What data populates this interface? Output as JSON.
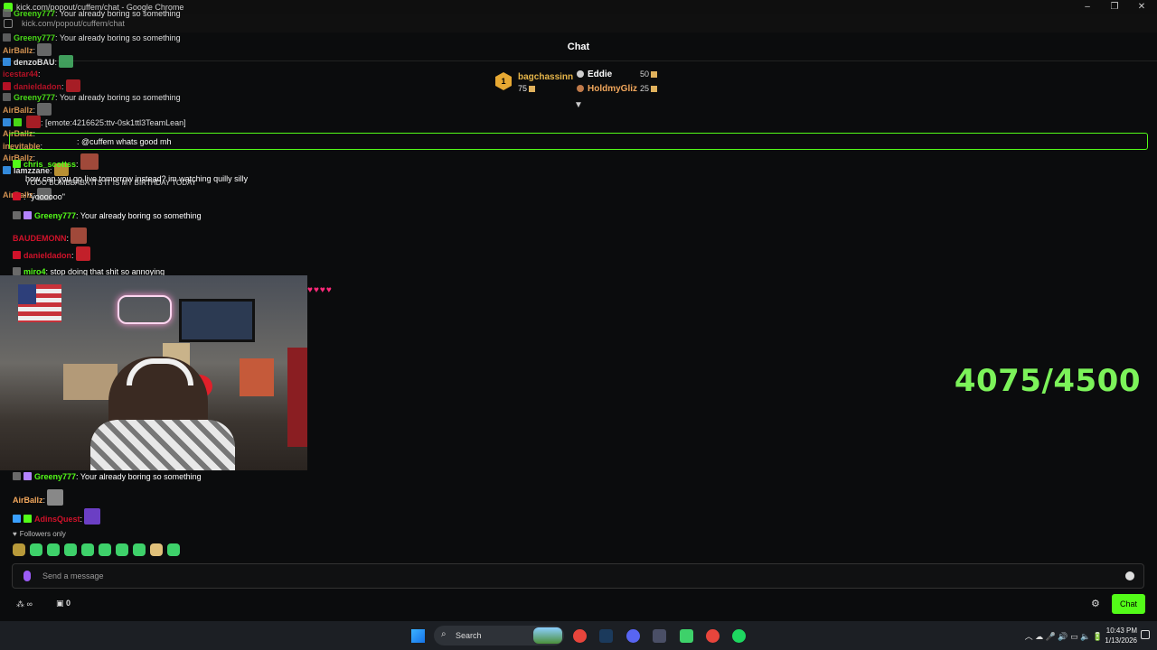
{
  "browser": {
    "title": "kick.com/popout/cuffem/chat - Google Chrome",
    "url": "kick.com/popout/cuffem/chat"
  },
  "chat": {
    "header": "Chat",
    "leaderboard": {
      "first": {
        "rank": "1",
        "name": "bagchassinn",
        "count": "75"
      },
      "others": [
        {
          "name": "Eddie",
          "count": "50",
          "medal": "silver"
        },
        {
          "name": "HoldmyGliz",
          "count": "25",
          "medal": "bronze"
        }
      ]
    },
    "pinned": {
      "text": ": @cuffem whats good mh"
    },
    "ghost_messages": [
      {
        "user": "Greeny777",
        "text": ": Your already boring so something",
        "color": "#53fc18"
      },
      {
        "user": "Greeny777",
        "text": ": Your already boring so something",
        "color": "#53fc18"
      },
      {
        "user": "AirBallz",
        "text": ":",
        "color": "#f2a75c"
      },
      {
        "user": "denzoBAU",
        "text": ":",
        "color": "#ffffff"
      },
      {
        "user": "icestar44",
        "text": ":",
        "color": "#d1122a"
      },
      {
        "user": "danieldadon",
        "text": ":",
        "color": "#d1122a"
      },
      {
        "user": "Greeny777",
        "text": ": Your already boring so something",
        "color": "#53fc18"
      },
      {
        "user": "AirBallz",
        "text": ":",
        "color": "#f2a75c"
      },
      {
        "user": "",
        "text": ": [emote:4216625:ttv-0sk1ttl3TeamLean]",
        "color": "#ffffff"
      },
      {
        "user": "AirBallz",
        "text": ":",
        "color": "#f2a75c"
      },
      {
        "user": "inevitable",
        "text": ":",
        "color": "#f2a75c"
      },
      {
        "user": "AirBallz",
        "text": ":",
        "color": "#f2a75c"
      },
      {
        "user": "lamzzane",
        "text": ":",
        "color": "#ffffff"
      },
      {
        "user": "AirBallz",
        "text": ":",
        "color": "#f2a75c"
      }
    ],
    "messages": [
      {
        "user": "chris_scottss",
        "text": ":",
        "color": "#53fc18"
      },
      {
        "user": "",
        "text": "how can you go live tomorrow instead? im watching quilly silly",
        "color": "#ffffff"
      },
      {
        "user": "",
        "text": "YOOO BOMBBABA ITS IT IS MY BIRTHDAY TODAY",
        "color": "#ffffff"
      },
      {
        "user": "",
        "text": ": \"yoooooo\"",
        "color": "#ffffff"
      },
      {
        "user": "Greeny777",
        "text": ": Your already boring so something",
        "color": "#53fc18"
      },
      {
        "user": "BAUDEMONN",
        "text": ":",
        "color": "#d1122a"
      },
      {
        "user": "danieldadon",
        "text": ":",
        "color": "#d1122a"
      },
      {
        "user": "miro4",
        "text": ": stop doing that shit so annoying",
        "color": "#53fc18"
      },
      {
        "user": "Greeny777",
        "text": ": Your already boring so something",
        "color": "#53fc18"
      },
      {
        "user": "AirBallz",
        "text": ":",
        "color": "#f2a75c"
      },
      {
        "user": "AdinsQuest",
        "text": ":",
        "color": "#d1122a"
      }
    ],
    "hearts": "♥♥♥♥",
    "goal": "4075/4500",
    "followers_only": "Followers only",
    "input_placeholder": "Send a message",
    "gift_count": "0",
    "chat_button": "Chat"
  },
  "taskbar": {
    "search": "Search",
    "time": "10:43 PM",
    "date": "1/13/2026"
  },
  "colors": {
    "accent": "#53fc18",
    "goal": "#7cf35a",
    "background": "#0b0c0d"
  }
}
